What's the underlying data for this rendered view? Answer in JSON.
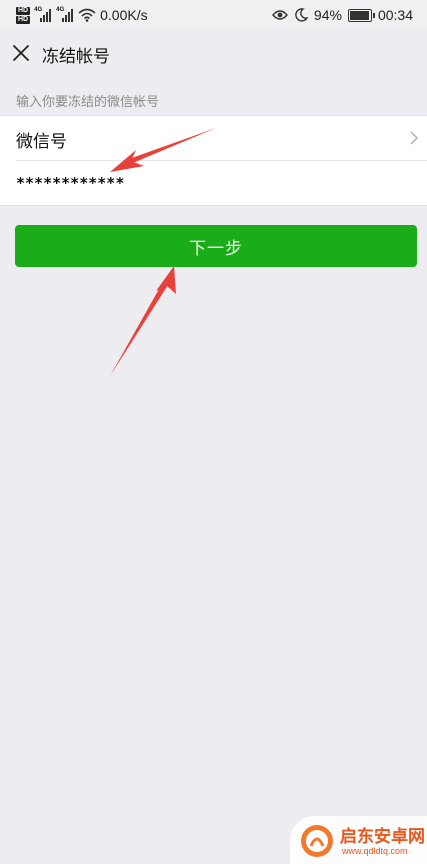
{
  "status_bar": {
    "network_speed": "0.00K/s",
    "network_type": "4G",
    "hd_label": "HD",
    "battery_percent": "94%",
    "battery_level": 0.94,
    "time": "00:34",
    "icons": [
      "hd-icon",
      "signal-icon",
      "wifi-icon",
      "eye-icon",
      "moon-icon",
      "battery-icon"
    ]
  },
  "header": {
    "title": "冻结帐号",
    "close_icon": "close-icon"
  },
  "form": {
    "hint": "输入你要冻结的微信帐号",
    "account_type_label": "微信号",
    "account_value": "************",
    "chevron_icon": "chevron-right-icon"
  },
  "actions": {
    "next_label": "下一步"
  },
  "colors": {
    "primary_green": "#1aad19",
    "background": "#ededf1",
    "annotation_red": "#e8413c"
  },
  "watermark": {
    "name": "启东安卓网",
    "url": "www.qdldtq.com"
  }
}
